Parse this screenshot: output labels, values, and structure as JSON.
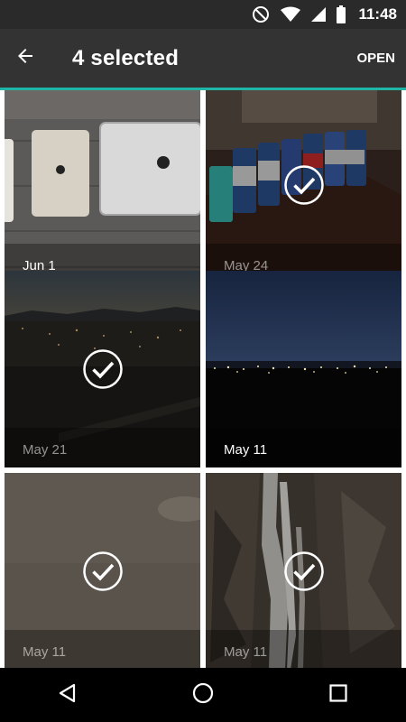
{
  "status_bar": {
    "time": "11:48",
    "icons": [
      "do-not-disturb-icon",
      "wifi-icon",
      "cell-signal-icon",
      "battery-icon"
    ]
  },
  "action_bar": {
    "back_icon": "arrow-back-icon",
    "title": "4 selected",
    "open_label": "OPEN",
    "accent_color": "#1fb6a8"
  },
  "photos": [
    {
      "date": "Jun 1",
      "selected": false,
      "subject": "tablet and laptop on table"
    },
    {
      "date": "May 24",
      "selected": true,
      "subject": "drink cans on table"
    },
    {
      "date": "May 21",
      "selected": true,
      "subject": "city lights at dusk"
    },
    {
      "date": "May 11",
      "selected": false,
      "subject": "city lights at night"
    },
    {
      "date": "May 11",
      "selected": true,
      "subject": "blurry gray scene"
    },
    {
      "date": "May 11",
      "selected": true,
      "subject": "waterfall on rock"
    }
  ],
  "nav_bar": {
    "buttons": [
      "back-triangle-icon",
      "home-circle-icon",
      "recents-square-icon"
    ]
  }
}
